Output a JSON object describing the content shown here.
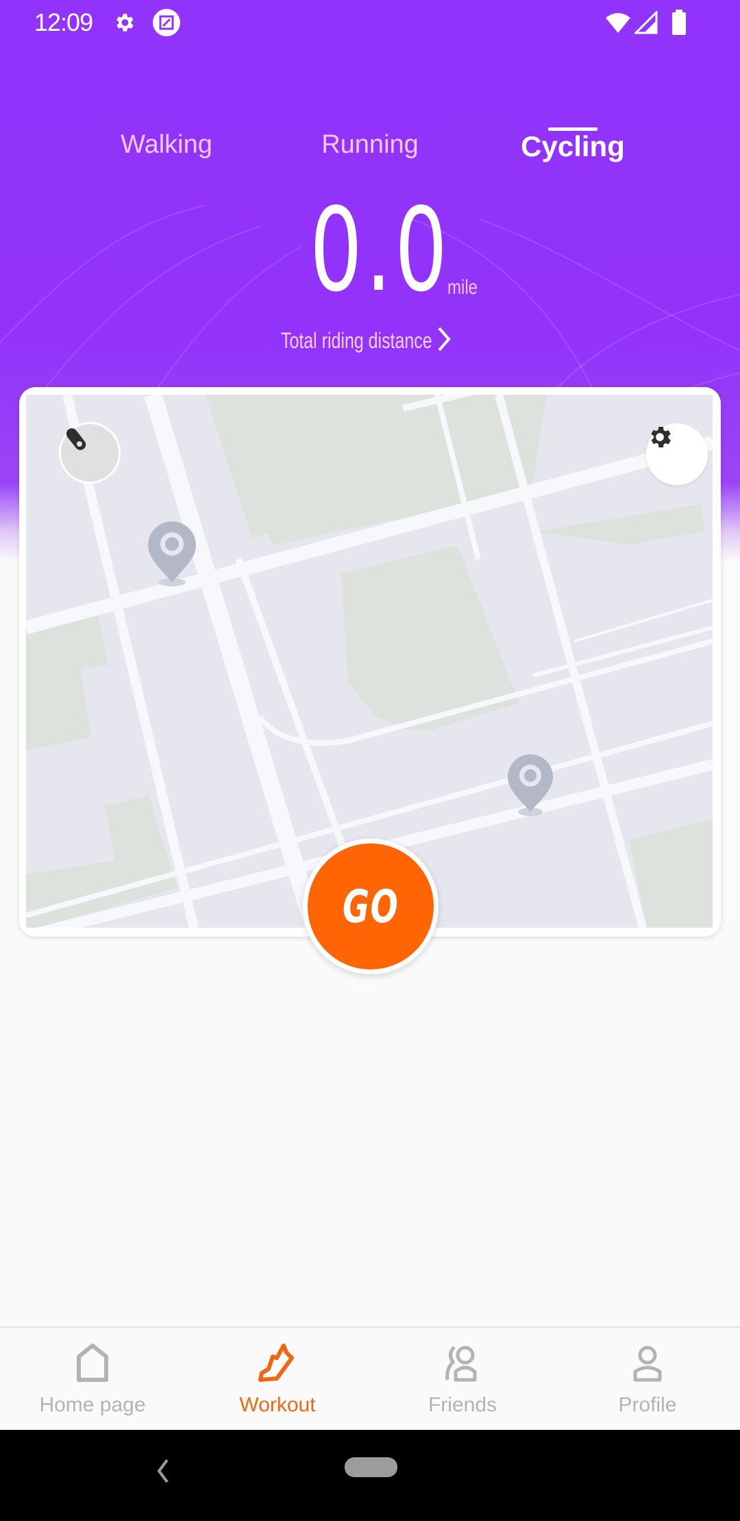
{
  "status_bar": {
    "time": "12:09",
    "left_icons": [
      "settings-gear-icon",
      "screenshot-edit-icon"
    ],
    "right_icons": [
      "wifi-icon",
      "cellular-signal-icon",
      "battery-icon"
    ]
  },
  "tabs": [
    {
      "label": "Walking",
      "active": false
    },
    {
      "label": "Running",
      "active": false
    },
    {
      "label": "Cycling",
      "active": true
    }
  ],
  "distance": {
    "value": "0.0",
    "unit": "mile",
    "total_link_label": "Total riding distance",
    "total_link_icon": "chevron-right-icon"
  },
  "map": {
    "left_button_icon": "bike-light-toggle-icon",
    "right_button_icon": "gear-icon",
    "pins": [
      "location-pin-icon",
      "location-pin-icon"
    ]
  },
  "go_button": {
    "label": "GO",
    "color": "#ff6405"
  },
  "bottom_nav": [
    {
      "label": "Home page",
      "icon": "home-icon",
      "active": false
    },
    {
      "label": "Workout",
      "icon": "shoe-icon",
      "active": true
    },
    {
      "label": "Friends",
      "icon": "friends-icon",
      "active": false
    },
    {
      "label": "Profile",
      "icon": "profile-icon",
      "active": false
    }
  ],
  "colors": {
    "primary_purple": "#9333fa",
    "accent_orange": "#ff6405",
    "active_nav": "#f0670f",
    "inactive_nav": "#b3b3b3"
  },
  "system_nav": {
    "back_icon": "back-chevron-icon",
    "home_icon": "home-pill"
  }
}
